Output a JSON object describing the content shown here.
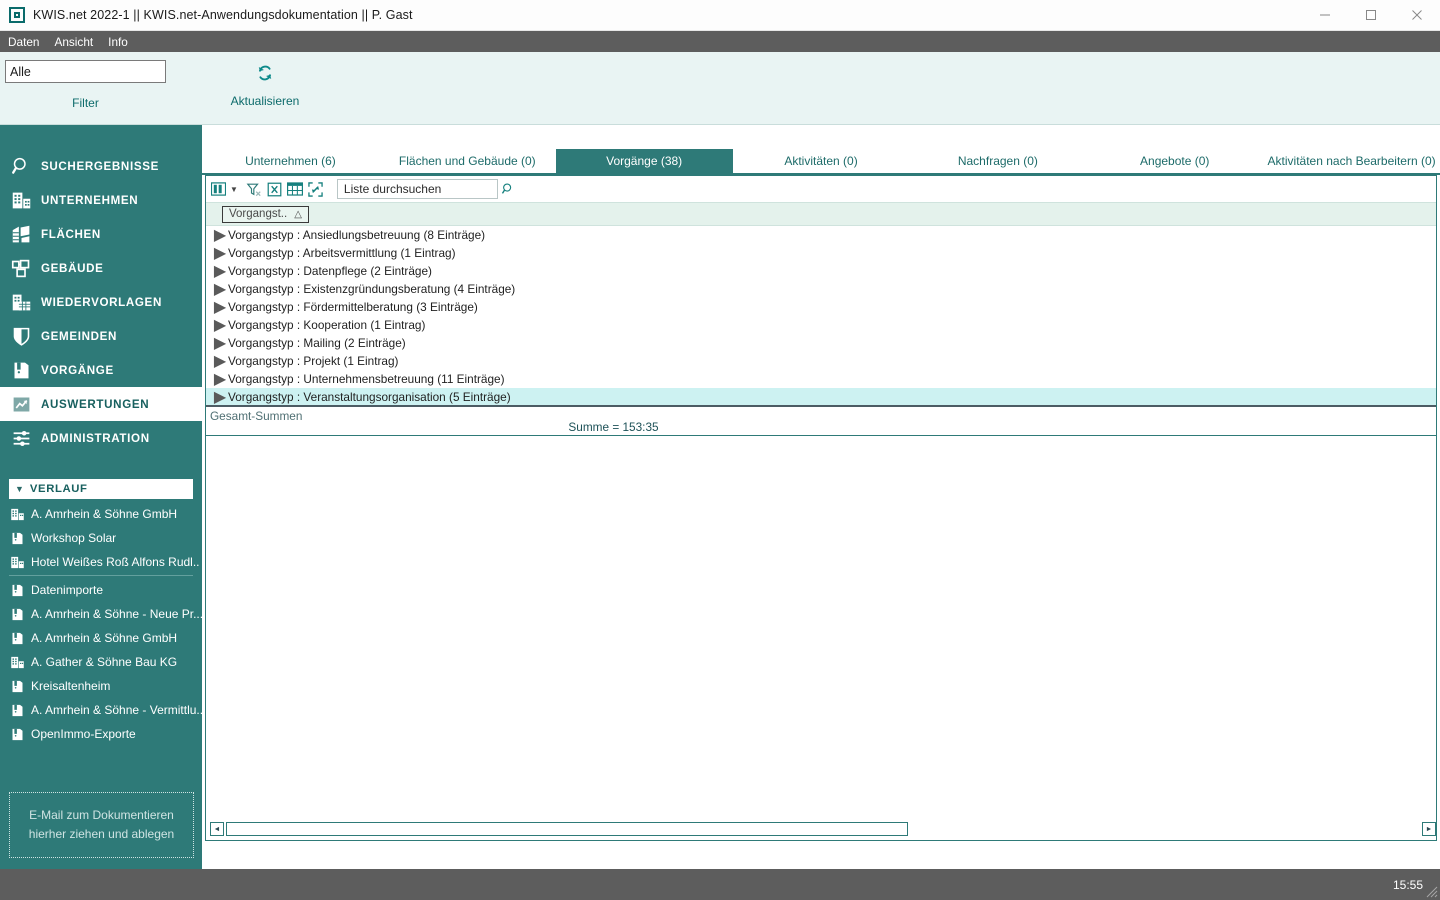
{
  "window": {
    "title": "KWIS.net 2022-1 || KWIS.net-Anwendungsdokumentation || P. Gast",
    "app_icon": "app-window-icon",
    "minimize_label": "—",
    "maximize_label": "□",
    "close_label": "✕"
  },
  "menubar": {
    "items": [
      {
        "label": "Daten"
      },
      {
        "label": "Ansicht"
      },
      {
        "label": "Info"
      }
    ]
  },
  "ribbon": {
    "filter": {
      "value": "Alle",
      "placeholder": "Alle",
      "group_label": "Filter"
    },
    "refresh": {
      "icon": "refresh-icon",
      "label": "Aktualisieren"
    }
  },
  "sidebar": {
    "nav": [
      {
        "label": "SUCHERGEBNISSE",
        "icon": "search-icon",
        "active": false
      },
      {
        "label": "UNTERNEHMEN",
        "icon": "company-icon",
        "active": false
      },
      {
        "label": "FLÄCHEN",
        "icon": "areas-icon",
        "active": false
      },
      {
        "label": "GEBÄUDE",
        "icon": "building-icon",
        "active": false
      },
      {
        "label": "WIEDERVORLAGEN",
        "icon": "calendar-icon",
        "active": false
      },
      {
        "label": "GEMEINDEN",
        "icon": "shield-icon",
        "active": false
      },
      {
        "label": "VORGÄNGE",
        "icon": "folder-binder-icon",
        "active": false
      },
      {
        "label": "AUSWERTUNGEN",
        "icon": "chart-report-icon",
        "active": true
      },
      {
        "label": "ADMINISTRATION",
        "icon": "sliders-icon",
        "active": false
      }
    ],
    "history": {
      "caret_icon": "chevron-down-icon",
      "title": "VERLAUF",
      "items": [
        {
          "label": "A. Amrhein & Söhne GmbH",
          "icon": "company-icon",
          "separator_after": false
        },
        {
          "label": "Workshop Solar",
          "icon": "folder-binder-icon",
          "separator_after": false
        },
        {
          "label": "Hotel Weißes Roß Alfons Rudl..",
          "icon": "company-icon",
          "separator_after": true
        },
        {
          "label": "Datenimporte",
          "icon": "folder-binder-icon",
          "separator_after": false
        },
        {
          "label": "A. Amrhein & Söhne - Neue Pr...",
          "icon": "folder-binder-icon",
          "separator_after": false
        },
        {
          "label": "A. Amrhein & Söhne GmbH",
          "icon": "folder-binder-icon",
          "separator_after": false
        },
        {
          "label": "A. Gather & Söhne Bau KG",
          "icon": "company-icon",
          "separator_after": false
        },
        {
          "label": "Kreisaltenheim",
          "icon": "folder-binder-icon",
          "separator_after": false
        },
        {
          "label": "A. Amrhein & Söhne - Vermittlu...",
          "icon": "folder-binder-icon",
          "separator_after": false
        },
        {
          "label": "OpenImmo-Exporte",
          "icon": "folder-binder-icon",
          "separator_after": false
        }
      ]
    },
    "dropzone": {
      "line1": "E-Mail  zum Dokumentieren",
      "line2": "hierher ziehen und ablegen"
    }
  },
  "main": {
    "tabs": [
      {
        "label": "Unternehmen (6)",
        "active": false
      },
      {
        "label": "Flächen und Gebäude (0)",
        "active": false
      },
      {
        "label": "Vorgänge (38)",
        "active": true
      },
      {
        "label": "Aktivitäten (0)",
        "active": false
      },
      {
        "label": "Nachfragen (0)",
        "active": false
      },
      {
        "label": "Angebote (0)",
        "active": false
      },
      {
        "label": "Aktivitäten nach Bearbeitern (0)",
        "active": false
      }
    ],
    "toolbar": {
      "icons": [
        {
          "name": "column-chooser-icon"
        },
        {
          "name": "chevron-down-icon"
        },
        {
          "name": "clear-filter-icon"
        },
        {
          "name": "export-excel-icon"
        },
        {
          "name": "layout-grid-icon"
        },
        {
          "name": "expand-collapse-icon"
        }
      ],
      "search": {
        "value": "Liste durchsuchen",
        "placeholder": "Liste durchsuchen",
        "icon": "search-icon"
      }
    },
    "groupbar": {
      "chip_label": "Vorgangst..",
      "sort_icon": "sort-ascending-icon"
    },
    "grid_rows": [
      {
        "expander": "▶",
        "text": "Vorgangstyp : Ansiedlungsbetreuung (8 Einträge)",
        "selected": false
      },
      {
        "expander": "▶",
        "text": "Vorgangstyp : Arbeitsvermittlung (1 Eintrag)",
        "selected": false
      },
      {
        "expander": "▶",
        "text": "Vorgangstyp : Datenpflege (2 Einträge)",
        "selected": false
      },
      {
        "expander": "▶",
        "text": "Vorgangstyp : Existenzgründungsberatung (4 Einträge)",
        "selected": false
      },
      {
        "expander": "▶",
        "text": "Vorgangstyp : Fördermittelberatung (3 Einträge)",
        "selected": false
      },
      {
        "expander": "▶",
        "text": "Vorgangstyp : Kooperation (1 Eintrag)",
        "selected": false
      },
      {
        "expander": "▶",
        "text": "Vorgangstyp : Mailing (2 Einträge)",
        "selected": false
      },
      {
        "expander": "▶",
        "text": "Vorgangstyp : Projekt (1 Eintrag)",
        "selected": false
      },
      {
        "expander": "▶",
        "text": "Vorgangstyp : Unternehmensbetreuung (11 Einträge)",
        "selected": false
      },
      {
        "expander": "▶",
        "text": "Vorgangstyp : Veranstaltungsorganisation (5 Einträge)",
        "selected": true
      }
    ],
    "summary": {
      "label": "Gesamt-Summen",
      "value": "Summe = 153:35"
    },
    "hscroll": {
      "left_arrow": "◄",
      "right_arrow": "►"
    }
  },
  "statusbar": {
    "clock": "15:55",
    "grip_icon": "resize-grip-icon"
  },
  "colors": {
    "teal": "#2e7a78",
    "teal_dark": "#18605f",
    "ribbon_bg": "#e9f4f3",
    "menubar_bg": "#5d5d5d",
    "selection": "#cdf2f2",
    "group_bar": "#e4f2ec",
    "accent_icon": "#16807e"
  }
}
